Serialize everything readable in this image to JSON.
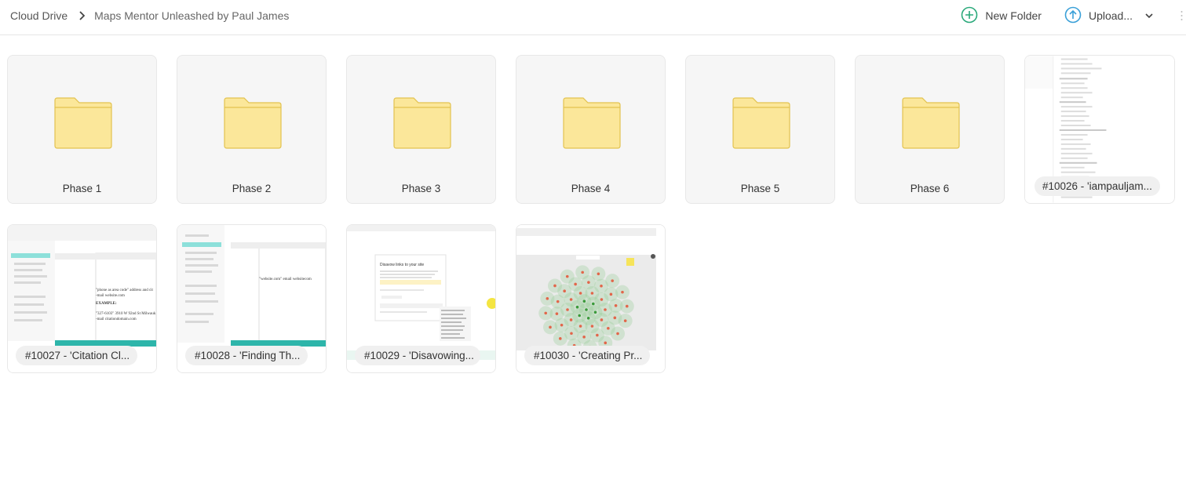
{
  "breadcrumb": {
    "root": "Cloud Drive",
    "current": "Maps Mentor Unleashed by Paul James"
  },
  "toolbar": {
    "new_folder_label": "New Folder",
    "upload_label": "Upload..."
  },
  "folders": [
    {
      "name": "Phase 1"
    },
    {
      "name": "Phase 2"
    },
    {
      "name": "Phase 3"
    },
    {
      "name": "Phase 4"
    },
    {
      "name": "Phase 5"
    },
    {
      "name": "Phase 6"
    }
  ],
  "files": [
    {
      "name": "#10026 - 'iampauljam..."
    },
    {
      "name": "#10027 - 'Citation Cl..."
    },
    {
      "name": "#10028 - 'Finding Th..."
    },
    {
      "name": "#10029 - 'Disavowing..."
    },
    {
      "name": "#10030 - 'Creating Pr..."
    }
  ],
  "thumbnails": {
    "citation_text": [
      "\"phone as area code\" address and cit",
      "-mail website.com",
      "EXAMPLE:",
      "\"327-6103\" 3910 W 92nd St Milwauk",
      "-mail citationdomain.com"
    ],
    "finding_text": "\"website.com\" email websitecom",
    "disavow_title": "Disavow links to your site"
  },
  "colors": {
    "accent_green": "#2aa97a",
    "accent_blue": "#3aa0d8",
    "folder_fill": "#fbe79a",
    "folder_stroke": "#e2c24f"
  }
}
